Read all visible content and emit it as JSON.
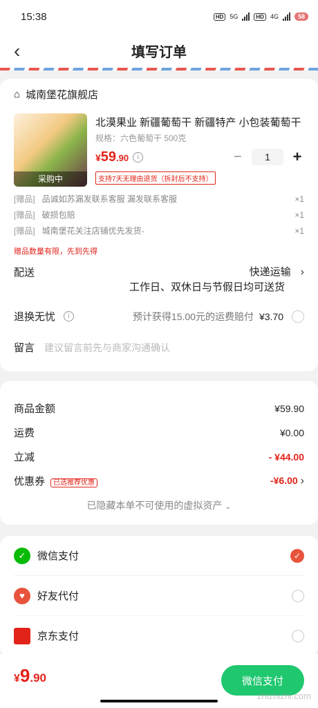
{
  "status": {
    "time": "15:38",
    "net1": "5G",
    "net2": "4G",
    "battery": "58"
  },
  "nav": {
    "title": "填写订单"
  },
  "shop": {
    "name": "城南堡花旗舰店"
  },
  "product": {
    "thumb_tag": "采购中",
    "name": "北漠果业 新疆葡萄干 新疆特产 小包装葡萄干",
    "spec": "规格：六色葡萄干 500克",
    "price_symbol": "¥",
    "price_int": "59",
    "price_dec": ".90",
    "quantity": "1",
    "policy": "支持7天无理由退货（拆封后不支持）"
  },
  "gifts": [
    {
      "tag": "[赠品]",
      "name": "品诚如苏漏发联系客服 漏发联系客服",
      "qty": "×1"
    },
    {
      "tag": "[赠品]",
      "name": "破损包赔",
      "qty": "×1"
    },
    {
      "tag": "[赠品]",
      "name": "城南堡花关注店铺优先发货-",
      "qty": "×1"
    }
  ],
  "gift_note": "赠品数量有限，先到先得",
  "delivery": {
    "label": "配送",
    "method": "快递运输",
    "note": "工作日、双休日与节假日均可送货"
  },
  "returns": {
    "label": "退换无忧",
    "note": "预计获得15.00元的运费赔付",
    "amount": "¥3.70"
  },
  "remark": {
    "label": "留言",
    "placeholder": "建议留言前先与商家沟通确认"
  },
  "summary": {
    "goods_label": "商品金额",
    "goods_value": "¥59.90",
    "shipping_label": "运费",
    "shipping_value": "¥0.00",
    "discount_label": "立减",
    "discount_value": "- ¥44.00",
    "coupon_label": "优惠券",
    "coupon_tag": "已选推荐优惠",
    "coupon_value": "-¥6.00",
    "hidden_assets": "已隐藏本单不可使用的虚拟资产"
  },
  "payment": [
    {
      "name": "微信支付",
      "icon": "wechat-pay-icon",
      "color": "#09bb07",
      "selected": true
    },
    {
      "name": "好友代付",
      "icon": "friend-pay-icon",
      "color": "#e8533d",
      "selected": false
    },
    {
      "name": "京东支付",
      "icon": "jd-pay-icon",
      "color": "#e2231a",
      "selected": false
    }
  ],
  "footer": {
    "symbol": "¥",
    "total_int": "9",
    "total_dec": ".90",
    "pay_button": "微信支付"
  },
  "watermark": "zhizhizhi.com",
  "colors": {
    "accent": "#e2231a",
    "wechat": "#07c160"
  }
}
